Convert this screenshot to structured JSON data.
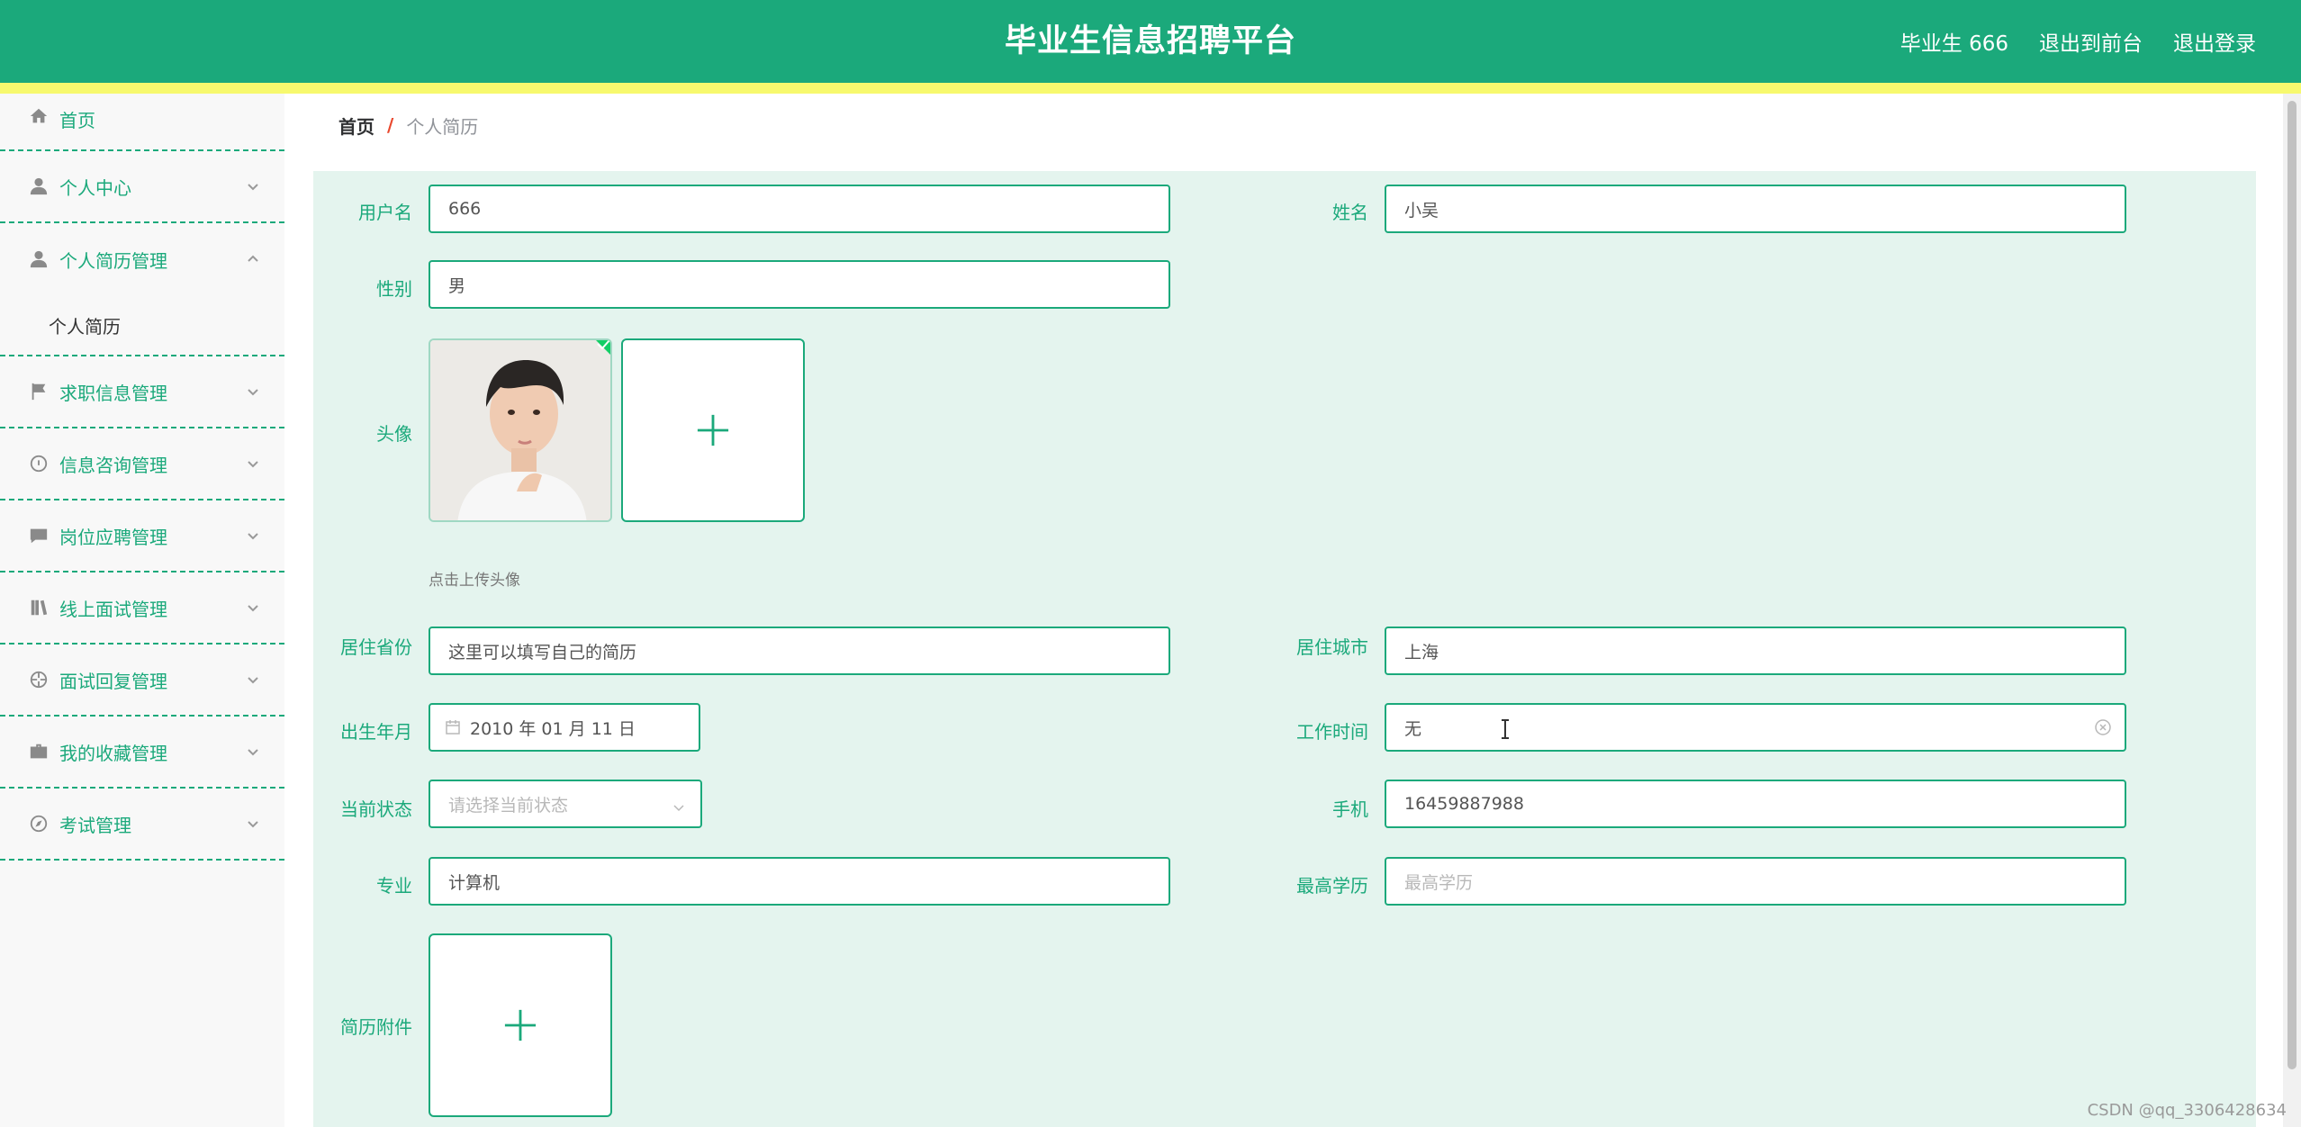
{
  "header": {
    "title": "毕业生信息招聘平台",
    "user_label": "毕业生 666",
    "back_to_front": "退出到前台",
    "logout": "退出登录"
  },
  "sidebar": {
    "items": [
      {
        "label": "首页",
        "icon": "home-icon"
      },
      {
        "label": "个人中心",
        "icon": "user-icon"
      },
      {
        "label": "个人简历管理",
        "icon": "user-icon",
        "expanded": true,
        "children": [
          "个人简历"
        ]
      },
      {
        "label": "求职信息管理",
        "icon": "flag-icon"
      },
      {
        "label": "信息咨询管理",
        "icon": "dashboard-icon"
      },
      {
        "label": "岗位应聘管理",
        "icon": "chat-icon"
      },
      {
        "label": "线上面试管理",
        "icon": "books-icon"
      },
      {
        "label": "面试回复管理",
        "icon": "crosshair-icon"
      },
      {
        "label": "我的收藏管理",
        "icon": "briefcase-icon"
      },
      {
        "label": "考试管理",
        "icon": "compass-icon"
      }
    ]
  },
  "breadcrumb": {
    "home": "首页",
    "separator": "/",
    "current": "个人简历"
  },
  "form": {
    "username": {
      "label": "用户名",
      "value": "666"
    },
    "name": {
      "label": "姓名",
      "value": "小吴"
    },
    "gender": {
      "label": "性别",
      "value": "男"
    },
    "avatar": {
      "label": "头像",
      "hint": "点击上传头像"
    },
    "province": {
      "label": "居住省份",
      "value": "这里可以填写自己的简历"
    },
    "city": {
      "label": "居住城市",
      "value": "上海"
    },
    "birth": {
      "label": "出生年月",
      "value": "2010 年 01 月 11 日"
    },
    "work_time": {
      "label": "工作时间",
      "value": "无"
    },
    "status": {
      "label": "当前状态",
      "placeholder": "请选择当前状态"
    },
    "phone": {
      "label": "手机",
      "value": "16459887988"
    },
    "major": {
      "label": "专业",
      "value": "计算机"
    },
    "education": {
      "label": "最高学历",
      "placeholder": "最高学历"
    },
    "attachment": {
      "label": "简历附件"
    }
  },
  "watermark": "CSDN @qq_3306428634",
  "colors": {
    "primary": "#1ba97b",
    "stripe": "#f7f96e",
    "form_bg": "#e4f4ee"
  }
}
